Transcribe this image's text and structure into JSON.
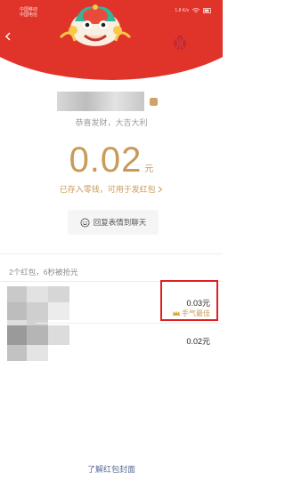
{
  "status": {
    "carrier_line1": "中国移动",
    "carrier_line2": "中国电信",
    "right_text": "1.8 K/s"
  },
  "packet": {
    "greeting": "恭喜发财，大吉大利",
    "amount": "0.02",
    "unit": "元",
    "stored_note": "已存入零钱，可用于发红包",
    "reply_label": "回复表情到聊天"
  },
  "summary": "2个红包，6秒被抢光",
  "recipients": [
    {
      "amount": "0.03元",
      "badge": "手气最佳"
    },
    {
      "amount": "0.02元"
    }
  ],
  "footer_link": "了解红包封面",
  "colors": {
    "header_red": "#e0342b",
    "gold": "#c99a58",
    "highlight": "#e02020",
    "link": "#576b95"
  }
}
